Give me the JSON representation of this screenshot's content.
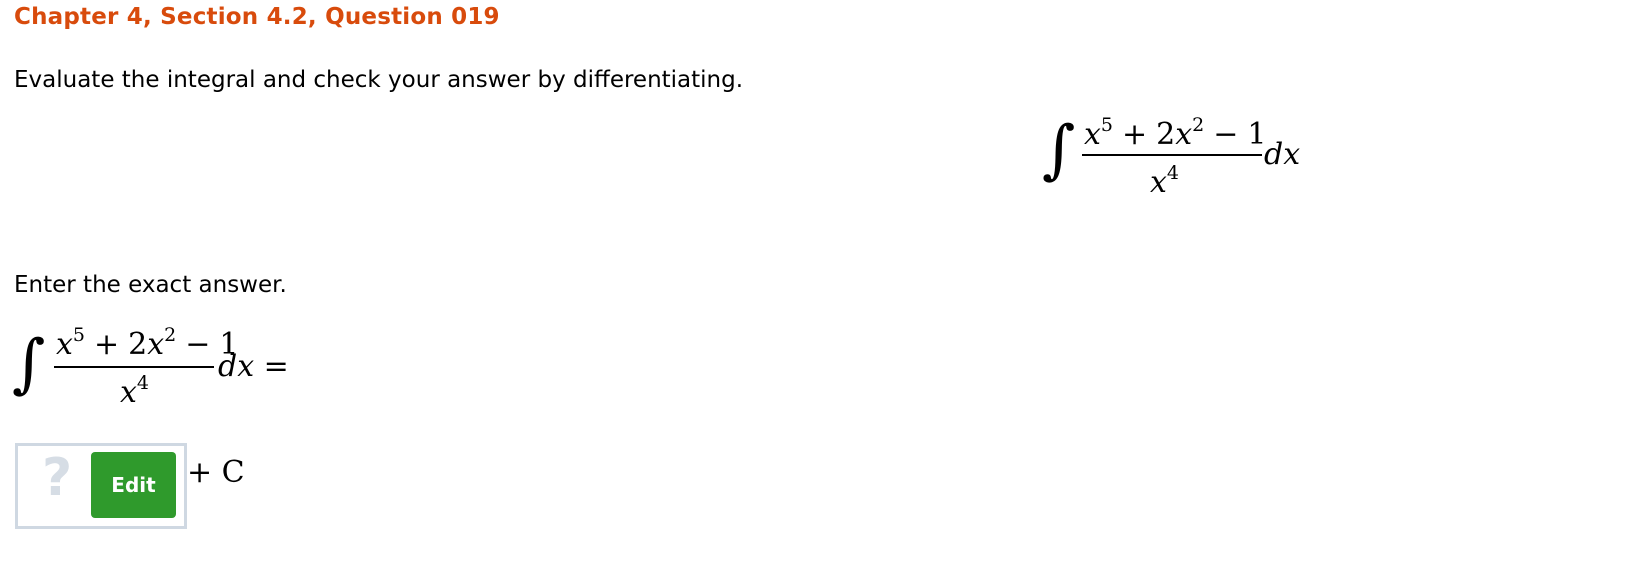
{
  "header": {
    "title": "Chapter 4, Section 4.2, Question 019"
  },
  "question": {
    "instruction": "Evaluate the integral and check your answer by differentiating.",
    "prompt": "Enter the exact answer.",
    "integral": {
      "sign": "∫",
      "numerator": {
        "term1_base": "x",
        "term1_exp": "5",
        "op1": "+",
        "term2_coef": "2",
        "term2_base": "x",
        "term2_exp": "2",
        "op2": "−",
        "term3": "1"
      },
      "denominator": {
        "base": "x",
        "exp": "4"
      },
      "differential": "dx",
      "equals": "="
    }
  },
  "answer": {
    "placeholder_icon": "question-mark-icon",
    "placeholder_glyph": "?",
    "edit_label": "Edit",
    "constant": "+ C"
  },
  "colors": {
    "heading": "#d84b0c",
    "edit_button": "#2f9a2c",
    "answer_border": "#cfd8e2",
    "placeholder": "#d6dde5"
  }
}
